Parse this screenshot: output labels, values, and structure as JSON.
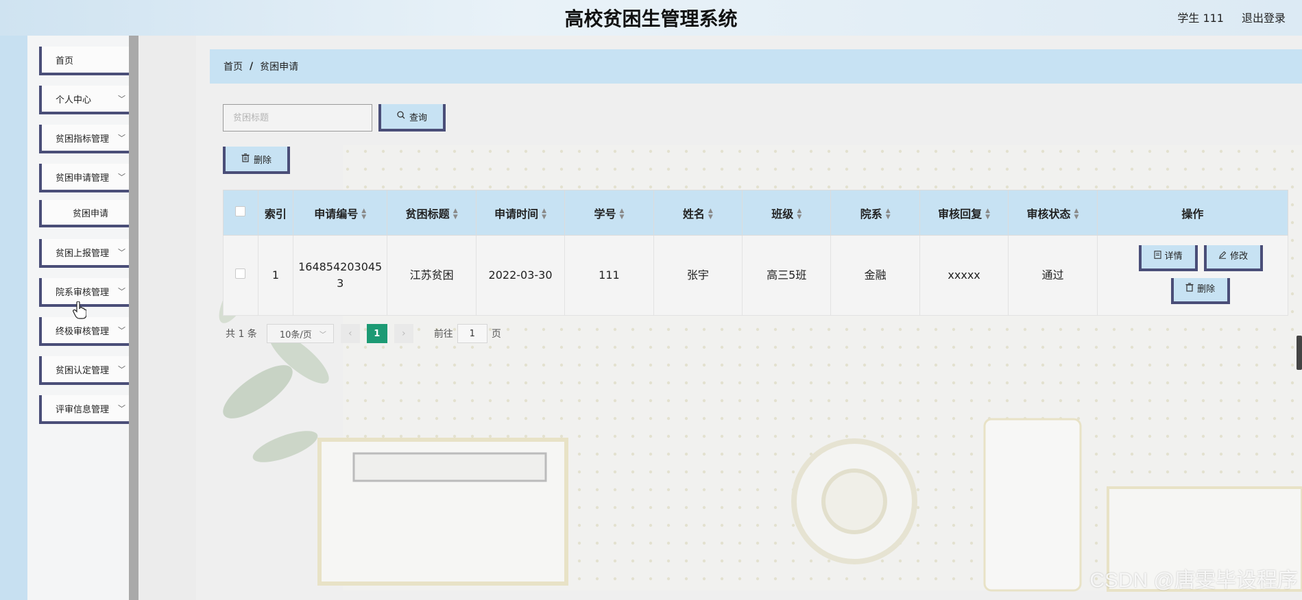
{
  "header": {
    "title": "高校贫困生管理系统",
    "user_label": "学生 111",
    "logout_label": "退出登录"
  },
  "sidebar": {
    "items": [
      {
        "label": "首页",
        "has_children": false
      },
      {
        "label": "个人中心",
        "has_children": true
      },
      {
        "label": "贫困指标管理",
        "has_children": true
      },
      {
        "label": "贫困申请管理",
        "has_children": true
      },
      {
        "label": "贫困申请",
        "is_sub": true
      },
      {
        "label": "贫困上报管理",
        "has_children": true
      },
      {
        "label": "院系审核管理",
        "has_children": true
      },
      {
        "label": "终极审核管理",
        "has_children": true
      },
      {
        "label": "贫困认定管理",
        "has_children": true
      },
      {
        "label": "评审信息管理",
        "has_children": true
      }
    ]
  },
  "breadcrumb": {
    "home": "首页",
    "separator": "/",
    "current": "贫困申请"
  },
  "search": {
    "placeholder": "贫困标题",
    "value": "",
    "query_label": "查询"
  },
  "toolbar": {
    "delete_label": "删除"
  },
  "table": {
    "columns": [
      "索引",
      "申请编号",
      "贫困标题",
      "申请时间",
      "学号",
      "姓名",
      "班级",
      "院系",
      "审核回复",
      "审核状态",
      "操作"
    ],
    "rows": [
      {
        "index": "1",
        "apply_no": "1648542030453",
        "title": "江苏贫困",
        "apply_time": "2022-03-30",
        "student_no": "111",
        "name": "张宇",
        "class": "高三5班",
        "department": "金融",
        "review_reply": "xxxxx",
        "review_status": "通过",
        "actions": {
          "detail": "详情",
          "edit": "修改",
          "delete": "删除"
        }
      }
    ]
  },
  "pagination": {
    "total_text": "共 1 条",
    "page_size": "10条/页",
    "current_page": "1",
    "goto_label": "前往",
    "goto_value": "1",
    "page_suffix": "页"
  },
  "watermark": "CSDN @唐雯毕设程序",
  "colors": {
    "accent_blue": "#c7e2f3",
    "border_navy": "#4a4e78",
    "page_active": "#1c9a74"
  }
}
